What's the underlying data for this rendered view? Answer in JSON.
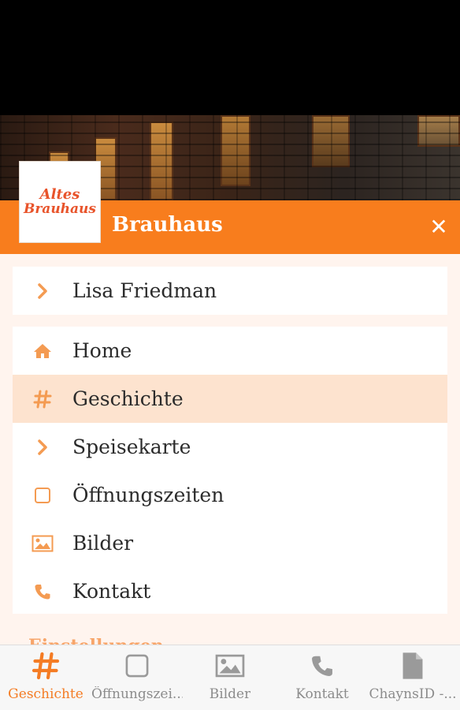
{
  "header": {
    "logo_line1": "Altes",
    "logo_line2": "Brauhaus",
    "title": "Brauhaus",
    "close_symbol": "✕"
  },
  "user": {
    "name": "Lisa Friedman",
    "icon": "chevron-right-icon"
  },
  "menu": {
    "items": [
      {
        "label": "Home",
        "icon": "home-icon",
        "active": false
      },
      {
        "label": "Geschichte",
        "icon": "hash-icon",
        "active": true
      },
      {
        "label": "Speisekarte",
        "icon": "chevron-right-icon",
        "active": false
      },
      {
        "label": "Öffnungszeiten",
        "icon": "square-icon",
        "active": false
      },
      {
        "label": "Bilder",
        "icon": "image-icon",
        "active": false
      },
      {
        "label": "Kontakt",
        "icon": "phone-icon",
        "active": false
      }
    ]
  },
  "partial_heading": "Einstellungen",
  "tabs": [
    {
      "label": "Geschichte",
      "icon": "hash-icon",
      "active": true
    },
    {
      "label": "Öffnungszei...",
      "icon": "square-icon",
      "active": false
    },
    {
      "label": "Bilder",
      "icon": "image-icon",
      "active": false
    },
    {
      "label": "Kontakt",
      "icon": "phone-icon",
      "active": false
    },
    {
      "label": "ChaynsID -...",
      "icon": "document-icon",
      "active": false
    }
  ],
  "colors": {
    "accent": "#f87d1d",
    "active_row": "#fde3cf",
    "icon_orange": "#f49b52"
  }
}
